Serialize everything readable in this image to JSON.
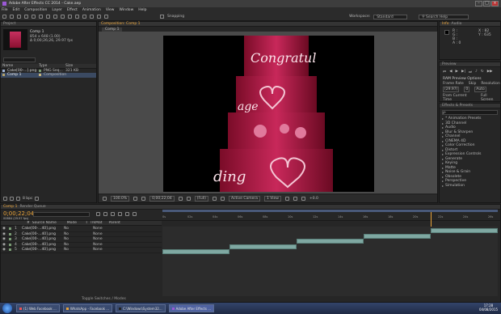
{
  "window": {
    "title": "Adobe After Effects CC 2014 - Cake.aep"
  },
  "menu": [
    "File",
    "Edit",
    "Composition",
    "Layer",
    "Effect",
    "Animation",
    "View",
    "Window",
    "Help"
  ],
  "toolbar": {
    "snapping": "Snapping",
    "workspace_label": "Workspace:",
    "workspace": "Standard",
    "search": "Search Help"
  },
  "project": {
    "tab": "Project",
    "thumb_name": "Comp 1",
    "thumb_info1": "854 x 648 (1.00)",
    "thumb_info2": "Δ 0;00;26;26, 29.97 fps",
    "columns": [
      "Name",
      "Type",
      "Size"
    ],
    "items": [
      {
        "name": "Cake[00-...].png",
        "type": "PNG Seq...",
        "size": "321 KB"
      },
      {
        "name": "Comp 1",
        "type": "Composition",
        "size": ""
      }
    ],
    "bpc": "8 bpc"
  },
  "comp_viewer": {
    "tab": "Composition: Comp 1",
    "sub_tab": "Comp 1",
    "zoom": "100.0%",
    "timecode": "0;00;22;04",
    "resolution": "(Full)",
    "camera": "Active Camera",
    "views": "1 View",
    "offset": "+0.0",
    "cake_text": {
      "top": "Congratul",
      "mid": "age",
      "bottom": "ding"
    }
  },
  "info": {
    "tab": "Info",
    "tab2": "Audio",
    "r": "R :",
    "g": "G :",
    "b": "B :",
    "a": "A : 0",
    "x": "X : 82",
    "y": "Y : 635"
  },
  "preview": {
    "tab": "Preview",
    "options": "RAM Preview Options",
    "frame_rate_label": "Frame Rate",
    "frame_rate": "(29.97)",
    "skip_label": "Skip",
    "skip": "0",
    "res_label": "Resolution",
    "res": "Auto",
    "from_current": "From Current Time",
    "full_screen": "Full Screen"
  },
  "effects": {
    "tab": "Effects & Presets",
    "search": "ρ·",
    "items": [
      "* Animation Presets",
      "3D Channel",
      "Audio",
      "Blur & Sharpen",
      "Channel",
      "CINEMA 4D",
      "Color Correction",
      "Distort",
      "Expression Controls",
      "Generate",
      "Keying",
      "Matte",
      "Noise & Grain",
      "Obsolete",
      "Perspective",
      "Simulation"
    ]
  },
  "timeline": {
    "tab": "Comp 1",
    "tab2": "Render Queue",
    "timecode": "0;00;22;04",
    "frame_info": "00664 (29.97 fps)",
    "columns": [
      "#",
      "Source Name",
      "Mode",
      "T",
      "TrkMat",
      "Parent"
    ],
    "layers": [
      {
        "num": "1",
        "name": "Cake[00-...40].png",
        "mode": "No",
        "parent": "None",
        "bar_start": 0.8,
        "bar_end": 1.0
      },
      {
        "num": "2",
        "name": "Cake[00-...40].png",
        "mode": "No",
        "parent": "None",
        "bar_start": 0.6,
        "bar_end": 0.8
      },
      {
        "num": "3",
        "name": "Cake[00-...40].png",
        "mode": "No",
        "parent": "None",
        "bar_start": 0.4,
        "bar_end": 0.6
      },
      {
        "num": "4",
        "name": "Cake[00-...40].png",
        "mode": "No",
        "parent": "None",
        "bar_start": 0.2,
        "bar_end": 0.4
      },
      {
        "num": "5",
        "name": "Cake[00-...40].png",
        "mode": "No",
        "parent": "None",
        "bar_start": 0.0,
        "bar_end": 0.2
      }
    ],
    "ticks": [
      "0s",
      "02s",
      "04s",
      "06s",
      "08s",
      "10s",
      "12s",
      "14s",
      "16s",
      "18s",
      "20s",
      "22s",
      "24s",
      "26s"
    ],
    "playhead": 0.8,
    "toggle": "Toggle Switches / Modes"
  },
  "taskbar": {
    "tasks": [
      "(1) Web Facebook ...",
      "WhatsApp - Facebook ...",
      "C:\\Windows\\System32...",
      "Adobe After Effects ..."
    ],
    "clock": "17:28",
    "date": "04/08/2015"
  },
  "colors": {
    "accent": "#e8a33a",
    "bars": "#7fa8a2",
    "cake": "#b81e48"
  }
}
